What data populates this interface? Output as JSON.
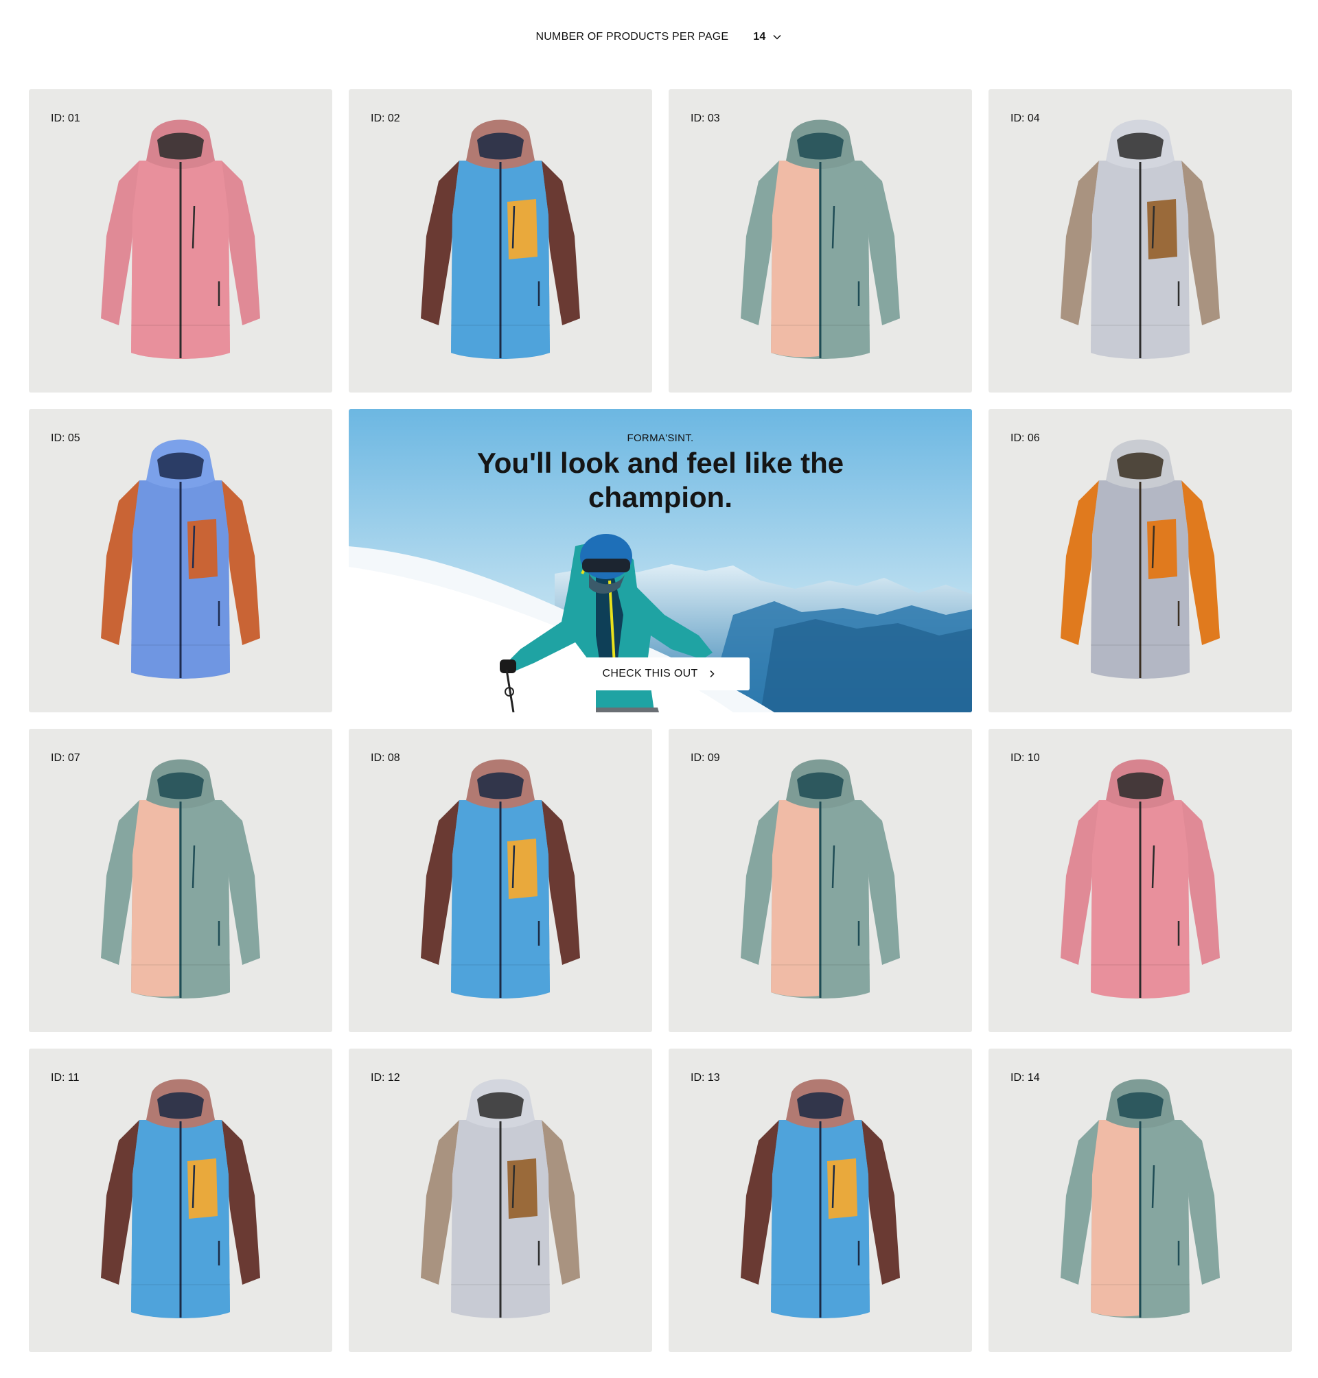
{
  "toolbar": {
    "per_page_label": "NUMBER OF PRODUCTS PER PAGE",
    "per_page_value": "14",
    "dropdown_icon": "chevron-down-icon"
  },
  "banner": {
    "brand": "FORMA'SINT.",
    "headline": "You'll look and feel like the champion.",
    "cta_label": "CHECK THIS OUT",
    "cta_icon": "chevron-right-icon"
  },
  "products": [
    {
      "id_label": "ID: 01",
      "colors": {
        "body": "#e8909c",
        "left": "#e8909c",
        "right": "#e8909c",
        "sleeve_l": "#e08a96",
        "sleeve_r": "#e08a96",
        "hood": "#d7848f",
        "pocket": "#e8909c",
        "trim": "#2b2b2b"
      }
    },
    {
      "id_label": "ID: 02",
      "colors": {
        "body": "#4fa3db",
        "left": "#4fa3db",
        "right": "#4fa3db",
        "sleeve_l": "#6a3a33",
        "sleeve_r": "#6a3a33",
        "hood": "#b27a72",
        "pocket": "#e9a93c",
        "trim": "#1b2a44"
      }
    },
    {
      "id_label": "ID: 03",
      "colors": {
        "body": "#86a6a0",
        "left": "#f0bba6",
        "right": "#86a6a0",
        "sleeve_l": "#86a6a0",
        "sleeve_r": "#86a6a0",
        "hood": "#7e9c96",
        "pocket": "#86a6a0",
        "trim": "#1f4c55"
      }
    },
    {
      "id_label": "ID: 04",
      "colors": {
        "body": "#c8cbd4",
        "left": "#c8cbd4",
        "right": "#c8cbd4",
        "sleeve_l": "#a99380",
        "sleeve_r": "#a99380",
        "hood": "#d3d6de",
        "pocket": "#9a6a3a",
        "trim": "#2d2d2d"
      }
    },
    {
      "id_label": "ID: 05",
      "colors": {
        "body": "#6f96e2",
        "left": "#6f96e2",
        "right": "#6f96e2",
        "sleeve_l": "#c96435",
        "sleeve_r": "#c96435",
        "hood": "#7ba1ea",
        "pocket": "#c96435",
        "trim": "#1d2b4f"
      }
    },
    {
      "id_label": "ID: 06",
      "colors": {
        "body": "#b3b7c4",
        "left": "#b3b7c4",
        "right": "#b3b7c4",
        "sleeve_l": "#e07a1e",
        "sleeve_r": "#e07a1e",
        "hood": "#c9ccd2",
        "pocket": "#e07a1e",
        "trim": "#3a2f22"
      }
    },
    {
      "id_label": "ID: 07",
      "colors": {
        "body": "#86a6a0",
        "left": "#f0bba6",
        "right": "#86a6a0",
        "sleeve_l": "#86a6a0",
        "sleeve_r": "#86a6a0",
        "hood": "#7e9c96",
        "pocket": "#86a6a0",
        "trim": "#1f4c55"
      }
    },
    {
      "id_label": "ID: 08",
      "colors": {
        "body": "#4fa3db",
        "left": "#4fa3db",
        "right": "#4fa3db",
        "sleeve_l": "#6a3a33",
        "sleeve_r": "#6a3a33",
        "hood": "#b27a72",
        "pocket": "#e9a93c",
        "trim": "#1b2a44"
      }
    },
    {
      "id_label": "ID: 09",
      "colors": {
        "body": "#86a6a0",
        "left": "#f0bba6",
        "right": "#86a6a0",
        "sleeve_l": "#86a6a0",
        "sleeve_r": "#86a6a0",
        "hood": "#7e9c96",
        "pocket": "#86a6a0",
        "trim": "#1f4c55"
      }
    },
    {
      "id_label": "ID: 10",
      "colors": {
        "body": "#e8909c",
        "left": "#e8909c",
        "right": "#e8909c",
        "sleeve_l": "#e08a96",
        "sleeve_r": "#e08a96",
        "hood": "#d7848f",
        "pocket": "#e8909c",
        "trim": "#2b2b2b"
      }
    },
    {
      "id_label": "ID: 11",
      "colors": {
        "body": "#4fa3db",
        "left": "#4fa3db",
        "right": "#4fa3db",
        "sleeve_l": "#6a3a33",
        "sleeve_r": "#6a3a33",
        "hood": "#b27a72",
        "pocket": "#e9a93c",
        "trim": "#1b2a44"
      }
    },
    {
      "id_label": "ID: 12",
      "colors": {
        "body": "#c8cbd4",
        "left": "#c8cbd4",
        "right": "#c8cbd4",
        "sleeve_l": "#a99380",
        "sleeve_r": "#a99380",
        "hood": "#d3d6de",
        "pocket": "#9a6a3a",
        "trim": "#2d2d2d"
      }
    },
    {
      "id_label": "ID: 13",
      "colors": {
        "body": "#4fa3db",
        "left": "#4fa3db",
        "right": "#4fa3db",
        "sleeve_l": "#6a3a33",
        "sleeve_r": "#6a3a33",
        "hood": "#b27a72",
        "pocket": "#e9a93c",
        "trim": "#1b2a44"
      }
    },
    {
      "id_label": "ID: 14",
      "colors": {
        "body": "#86a6a0",
        "left": "#f0bba6",
        "right": "#86a6a0",
        "sleeve_l": "#86a6a0",
        "sleeve_r": "#86a6a0",
        "hood": "#7e9c96",
        "pocket": "#86a6a0",
        "trim": "#1f4c55"
      }
    }
  ],
  "theme": {
    "card_background": "#e9e9e7",
    "sky_top": "#6cb7e2",
    "sky_bottom": "#d8ecf3"
  }
}
